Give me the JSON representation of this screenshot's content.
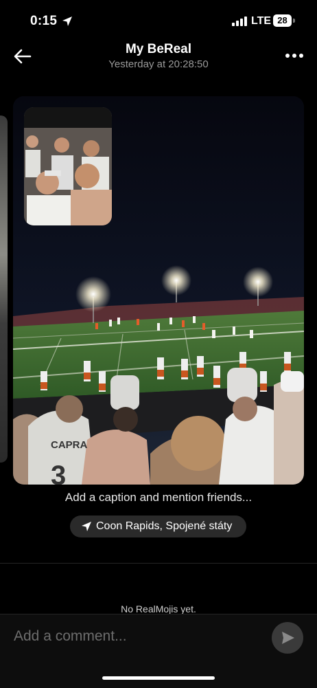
{
  "status_bar": {
    "time": "0:15",
    "network": "LTE",
    "battery": "28"
  },
  "header": {
    "title": "My BeReal",
    "subtitle": "Yesterday at 20:28:50"
  },
  "post": {
    "photo_label": "",
    "jersey_text": "CAPRA",
    "jersey_number": "3"
  },
  "caption": {
    "placeholder": "Add a caption and mention friends..."
  },
  "location": {
    "text": "Coon Rapids, Spojené státy"
  },
  "realmojis": {
    "empty_text": "No RealMojis yet."
  },
  "comment": {
    "placeholder": "Add a comment..."
  },
  "colors": {
    "background": "#000000",
    "pill": "#2a2a2a",
    "muted": "#9a9a9a"
  }
}
